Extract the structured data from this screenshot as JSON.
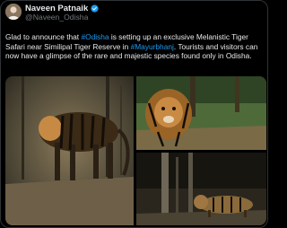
{
  "author": {
    "name": "Naveen Patnaik",
    "handle": "@Naveen_Odisha",
    "verified_icon": "verified-badge-icon"
  },
  "tweet": {
    "text_parts": [
      {
        "text": "Glad to announce that ",
        "kind": "text"
      },
      {
        "text": "#Odisha",
        "kind": "hashtag"
      },
      {
        "text": " is setting up an exclusive Melanistic Tiger Safari near Similipal Tiger Reserve in ",
        "kind": "text"
      },
      {
        "text": "#Mayurbhanj",
        "kind": "hashtag"
      },
      {
        "text": ". Tourists and visitors can now have a glimpse of the rare and majestic species found only in Odisha.",
        "kind": "text"
      }
    ]
  },
  "media": {
    "photo_count": 3
  },
  "colors": {
    "background": "#000000",
    "text": "#e7e9ea",
    "secondary_text": "#71767b",
    "link": "#1d9bf0",
    "border": "#2f3336"
  }
}
